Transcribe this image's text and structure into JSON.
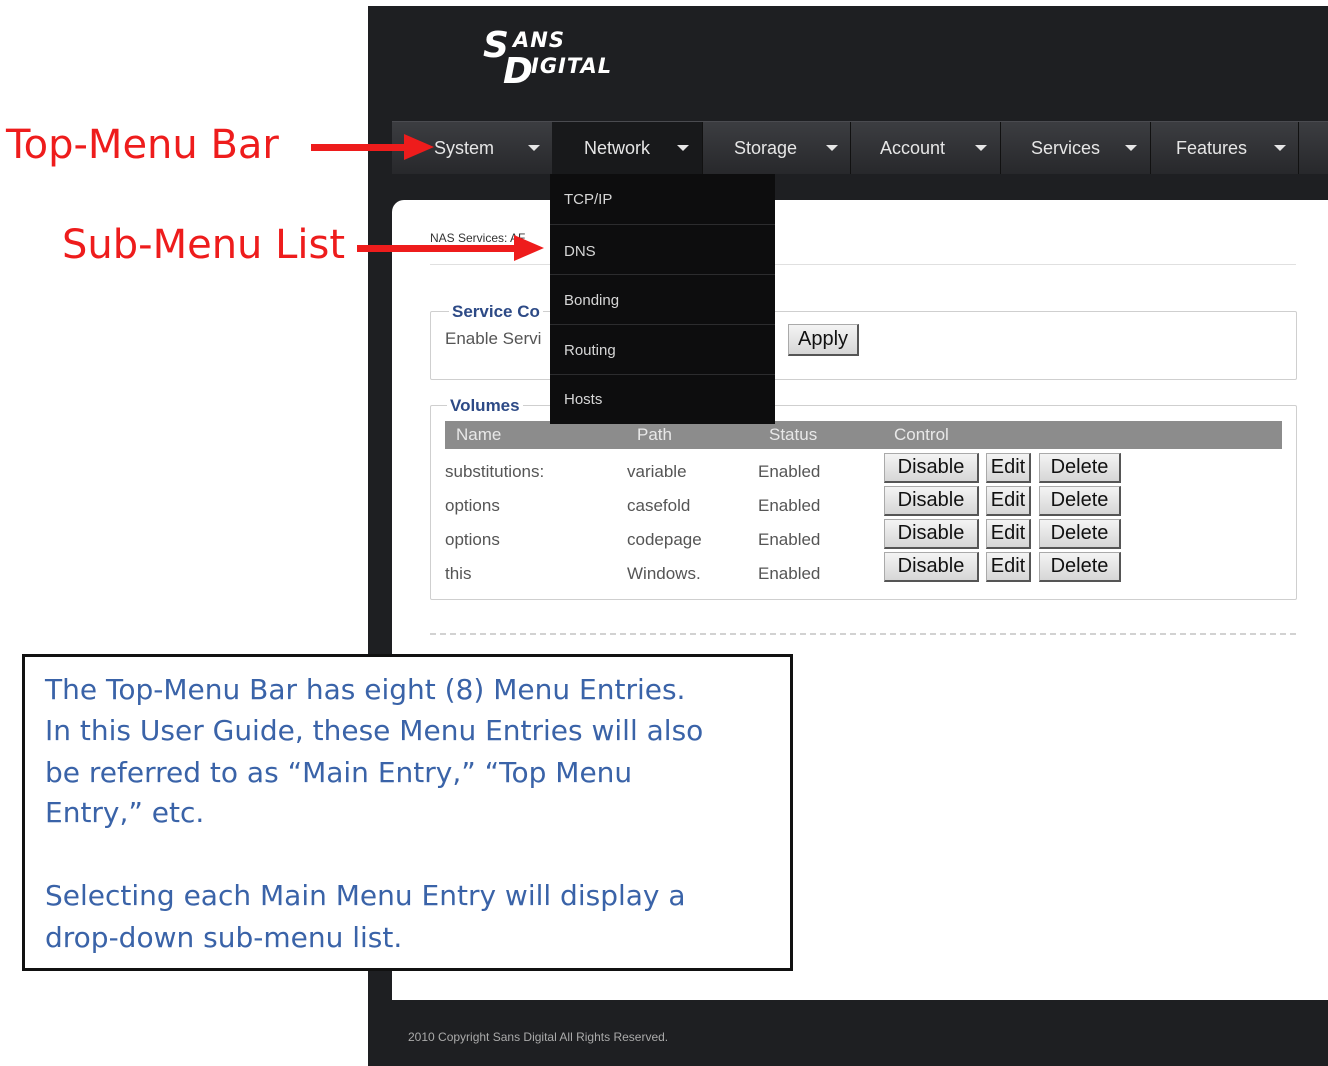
{
  "logo": {
    "line1": "SANS",
    "line2": "DIGITAL",
    "big1": "S",
    "big2": "D",
    "small1": "ANS",
    "small2": "IGITAL"
  },
  "top_menu": [
    {
      "label": "System"
    },
    {
      "label": "Network"
    },
    {
      "label": "Storage"
    },
    {
      "label": "Account"
    },
    {
      "label": "Services"
    },
    {
      "label": "Features"
    }
  ],
  "submenu": [
    "TCP/IP",
    "DNS",
    "Bonding",
    "Routing",
    "Hosts"
  ],
  "breadcrumb": "NAS Services: AF",
  "service_config": {
    "legend": "Service Co",
    "enable_label": "Enable Servi",
    "apply_label": "Apply"
  },
  "volumes": {
    "legend": "Volumes",
    "columns": [
      "Name",
      "Path",
      "Status",
      "Control"
    ],
    "rows": [
      {
        "name": "substitutions:",
        "path": "variable",
        "status": "Enabled"
      },
      {
        "name": "options",
        "path": "casefold",
        "status": "Enabled"
      },
      {
        "name": "options",
        "path": "codepage",
        "status": "Enabled"
      },
      {
        "name": "this",
        "path": "Windows.",
        "status": "Enabled"
      }
    ],
    "disable_label": "Disable",
    "edit_label": "Edit",
    "delete_label": "Delete"
  },
  "footer": "2010 Copyright Sans Digital All Rights Reserved.",
  "annotations": {
    "top_menu_bar": "Top-Menu Bar",
    "sub_menu_list": "Sub-Menu List",
    "callout_p1_l1": "The Top-Menu Bar has eight (8) Menu Entries.",
    "callout_p1_l2": "In this User Guide, these Menu Entries will also",
    "callout_p1_l3": "be referred to as “Main Entry,” “Top Menu",
    "callout_p1_l4": "Entry,” etc.",
    "callout_p2_l1": "Selecting each Main Menu Entry will display a",
    "callout_p2_l2": "drop-down sub-menu list."
  },
  "colors": {
    "annotation_red": "#ee1c1c",
    "callout_blue": "#3a63a8",
    "legend_blue": "#2d4a86"
  }
}
